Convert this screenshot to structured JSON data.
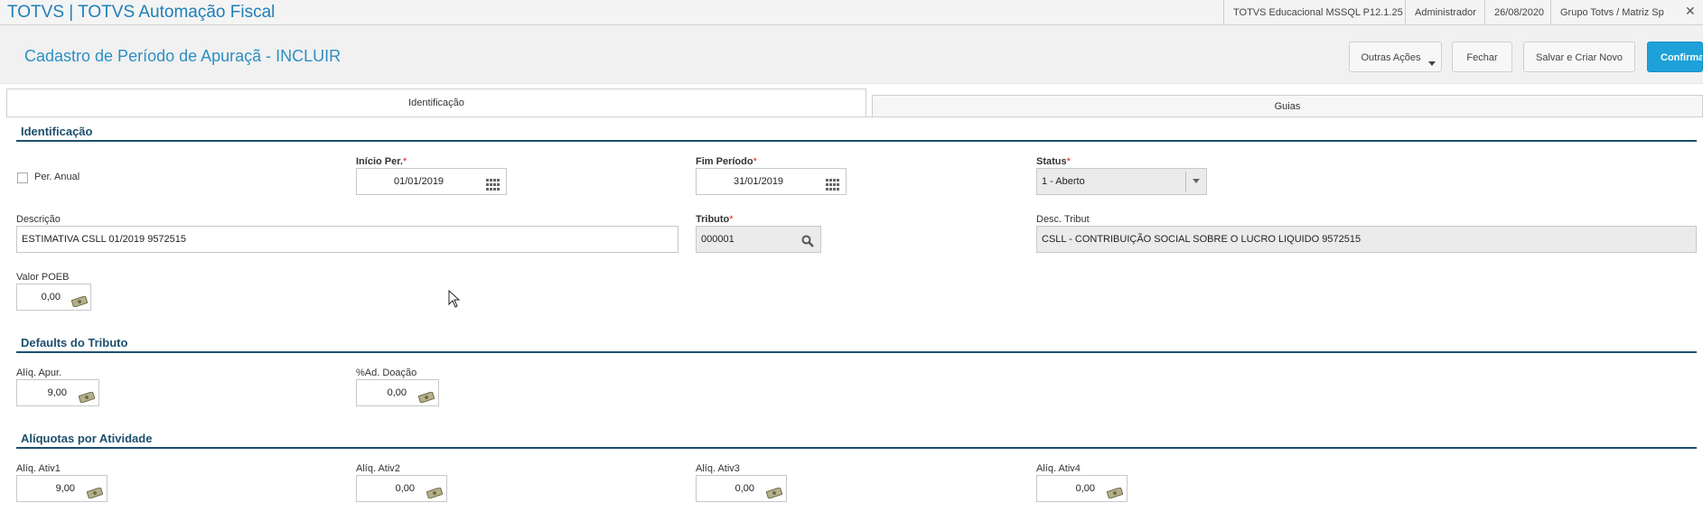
{
  "app": {
    "title": "TOTVS | TOTVS Automação Fiscal"
  },
  "topbar": {
    "system": "TOTVS Educacional MSSQL P12.1.25",
    "user": "Administrador",
    "date": "26/08/2020",
    "company": "Grupo Totvs / Matriz Sp",
    "close": "✕"
  },
  "header": {
    "title": "Cadastro de Período de Apuraçã - INCLUIR",
    "buttons": {
      "outras": "Outras Ações",
      "fechar": "Fechar",
      "salvar_novo": "Salvar e Criar Novo",
      "confirmar": "Confirmar"
    }
  },
  "tabs": [
    {
      "label": "Identificação",
      "active": true
    },
    {
      "label": "Guias",
      "active": false
    }
  ],
  "identificacao": {
    "section_title": "Identificação",
    "per_anual": {
      "label": "Per. Anual",
      "checked": false
    },
    "inicio_per": {
      "label": "Início Per.",
      "value": "01/01/2019"
    },
    "fim_periodo": {
      "label": "Fim Período",
      "value": "31/01/2019"
    },
    "status": {
      "label": "Status",
      "value": "1 - Aberto"
    },
    "descricao": {
      "label": "Descrição",
      "value": "ESTIMATIVA CSLL 01/2019 9572515"
    },
    "tributo": {
      "label": "Tributo",
      "value": "000001"
    },
    "desc_tribut": {
      "label": "Desc. Tribut",
      "value": "CSLL - CONTRIBUIÇÃO SOCIAL SOBRE O LUCRO LIQUIDO  9572515"
    },
    "valor_poeb": {
      "label": "Valor POEB",
      "value": "0,00"
    }
  },
  "defaults": {
    "section_title": "Defaults do Tributo",
    "aliq_apur": {
      "label": "Alíq. Apur.",
      "value": "9,00"
    },
    "ad_doacao": {
      "label": "%Ad. Doação",
      "value": "0,00"
    }
  },
  "aliquotas": {
    "section_title": "Alíquotas por Atividade",
    "ativ1": {
      "label": "Alíq. Ativ1",
      "value": "9,00"
    },
    "ativ2": {
      "label": "Alíq. Ativ2",
      "value": "0,00"
    },
    "ativ3": {
      "label": "Alíq. Ativ3",
      "value": "0,00"
    },
    "ativ4": {
      "label": "Alíq. Ativ4",
      "value": "0,00"
    }
  },
  "colors": {
    "accent": "#1da1d8",
    "section": "#1d4f6e",
    "title": "#2d8fc2",
    "required": "#e02020"
  }
}
